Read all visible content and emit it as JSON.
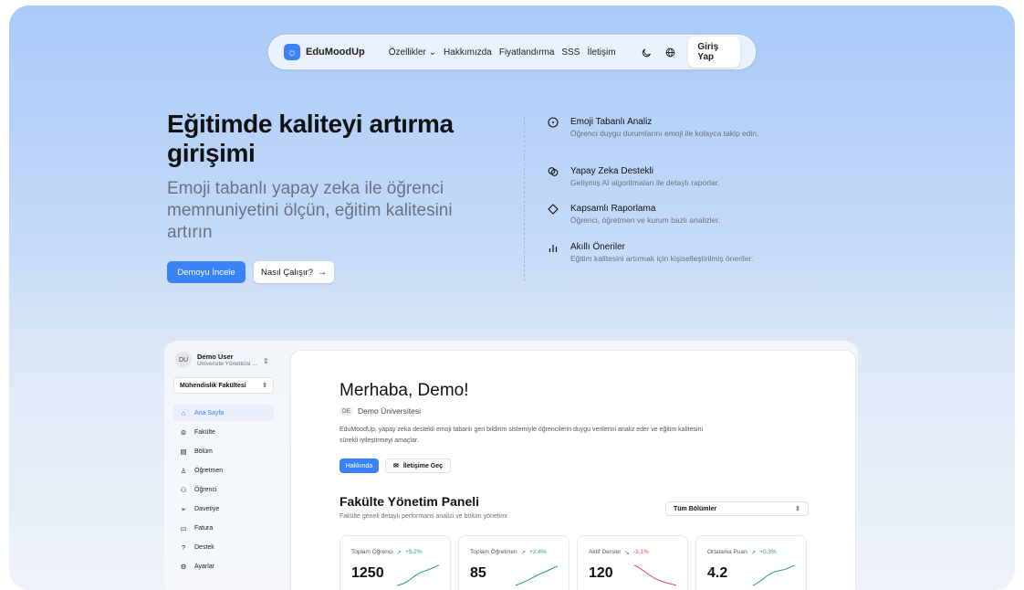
{
  "nav": {
    "brand": "EduMoodUp",
    "links": [
      "Özellikler ⌄",
      "Hakkımızda",
      "Fiyatlandırma",
      "SSS",
      "İletişim"
    ],
    "theme_icon": "moon-icon",
    "lang_icon": "globe-icon",
    "login": "Giriş Yap"
  },
  "hero": {
    "title": "Eğitimde kaliteyi artırma girişimi",
    "subtitle": "Emoji tabanlı yapay zeka ile öğrenci memnuniyetini ölçün, eğitim kalitesini artırın",
    "demo_button": "Demoyu İncele",
    "how_button": "Nasıl Çalışır?"
  },
  "features": [
    {
      "icon": "smile-icon",
      "title": "Emoji Tabanlı Analiz",
      "desc": "Öğrenci duygu durumlarını emoji ile kolayca takip edin."
    },
    {
      "icon": "ai-icon",
      "title": "Yapay Zeka Destekli",
      "desc": "Gelişmiş AI algoritmaları ile detaylı raporlar."
    },
    {
      "icon": "diamond-icon",
      "title": "Kapsamlı Raporlama",
      "desc": "Öğrenci, öğretmen ve kurum bazlı analizler."
    },
    {
      "icon": "bar-chart-icon",
      "title": "Akıllı Öneriler",
      "desc": "Eğitim kalitesini artırmak için kişiselleştirilmiş öneriler."
    }
  ],
  "app": {
    "user": {
      "initials": "DU",
      "name": "Demo User",
      "role": "Üniversite Yöneticisi ..."
    },
    "faculty_select": "Mühendislik Fakültesi",
    "sidebar": [
      {
        "icon": "home-icon",
        "label": "Ana Sayfa",
        "active": true
      },
      {
        "icon": "graduation-cap-icon",
        "label": "Fakülte"
      },
      {
        "icon": "building-icon",
        "label": "Bölüm"
      },
      {
        "icon": "teacher-icon",
        "label": "Öğretmen"
      },
      {
        "icon": "users-icon",
        "label": "Öğrenci"
      },
      {
        "icon": "send-icon",
        "label": "Davetiye"
      },
      {
        "icon": "card-icon",
        "label": "Fatura"
      },
      {
        "icon": "help-icon",
        "label": "Destek"
      },
      {
        "icon": "settings-icon",
        "label": "Ayarlar"
      }
    ],
    "greeting": "Merhaba, Demo!",
    "uni_badge": "DE",
    "uni_name": "Demo Üniversitesi",
    "description": "EduMoodUp, yapay zeka destekli emoji tabanlı geri bildirim sistemiyle öğrencilerin duygu verilerini analiz eder ve eğitim kalitesini sürekli iyileştirmeyi amaçlar.",
    "about_button": "Hakkında",
    "contact_button": "İletişime Geç",
    "panel_title": "Fakülte Yönetim Paneli",
    "panel_subtitle": "Fakülte geneli detaylı performans analizi ve bölüm yönetimi",
    "dept_select": "Tüm Bölümler",
    "stats": [
      {
        "label": "Toplam Öğrenci",
        "change": "+5.2%",
        "trend": "up",
        "value": "1250"
      },
      {
        "label": "Toplam Öğretmen",
        "change": "+2.4%",
        "trend": "up",
        "value": "85"
      },
      {
        "label": "Aktif Dersler",
        "change": "-3.1%",
        "trend": "down",
        "value": "120"
      },
      {
        "label": "Ortalama Puan",
        "change": "+0.3%",
        "trend": "up",
        "value": "4.2"
      }
    ]
  },
  "colors": {
    "accent": "#3b82f6",
    "positive": "#22a559",
    "negative": "#e24a4a"
  }
}
